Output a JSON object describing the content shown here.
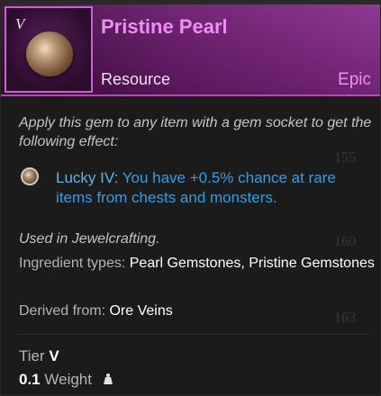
{
  "item": {
    "tier_mark": "V",
    "name": "Pristine Pearl",
    "type": "Resource",
    "rarity": "Epic",
    "description": "Apply this gem to any item with a gem socket to get the following effect:",
    "perk": {
      "name": "Lucky IV:",
      "text": "You have +0.5% chance at rare items from chests and monsters."
    },
    "used_in": "Used in Jewelcrafting.",
    "ingredient_label": "Ingredient types:",
    "ingredient_value": "Pearl Gemstones, Pristine Gemstones",
    "derived_label": "Derived from:",
    "derived_value": "Ore Veins",
    "tier_label": "Tier",
    "tier_value": "V",
    "weight_value": "0.1",
    "weight_label": "Weight"
  },
  "background_ghost": [
    "155",
    "160",
    "163"
  ],
  "colors": {
    "rarity_epic": "#f08cf5",
    "perk_blue": "#3c9be0",
    "header_purple": "#6a1a6c"
  }
}
